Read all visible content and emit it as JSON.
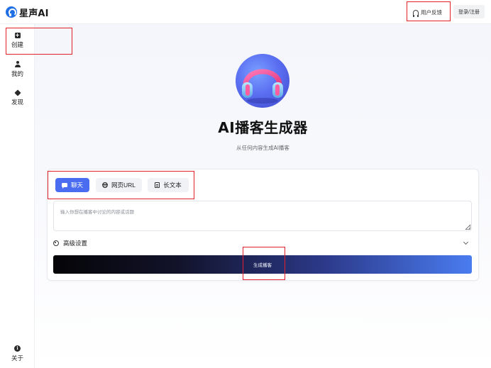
{
  "header": {
    "logo_text": "星声AI",
    "feedback_label": "用户反馈",
    "login_label": "登录/注册"
  },
  "sidebar": {
    "items": [
      {
        "label": "创建",
        "icon": "plus-square-icon"
      },
      {
        "label": "我的",
        "icon": "user-icon"
      },
      {
        "label": "发现",
        "icon": "cube-icon"
      }
    ],
    "bottom_item": {
      "label": "关于",
      "icon": "info-icon"
    }
  },
  "main": {
    "title": "AI播客生成器",
    "subtitle": "从任何内容生成AI播客",
    "tabs": [
      {
        "label": "聊天",
        "icon": "chat-icon",
        "active": true
      },
      {
        "label": "网页URL",
        "icon": "globe-icon",
        "active": false
      },
      {
        "label": "长文本",
        "icon": "doc-icon",
        "active": false
      }
    ],
    "input": {
      "value": "",
      "placeholder": "输入你想在播客中讨论的内容或话题"
    },
    "advanced_label": "高级设置",
    "generate_label": "生成播客"
  },
  "colors": {
    "accent": "#4a6cf0",
    "highlight": "#e0202a",
    "logo": "#1f6fe5"
  }
}
